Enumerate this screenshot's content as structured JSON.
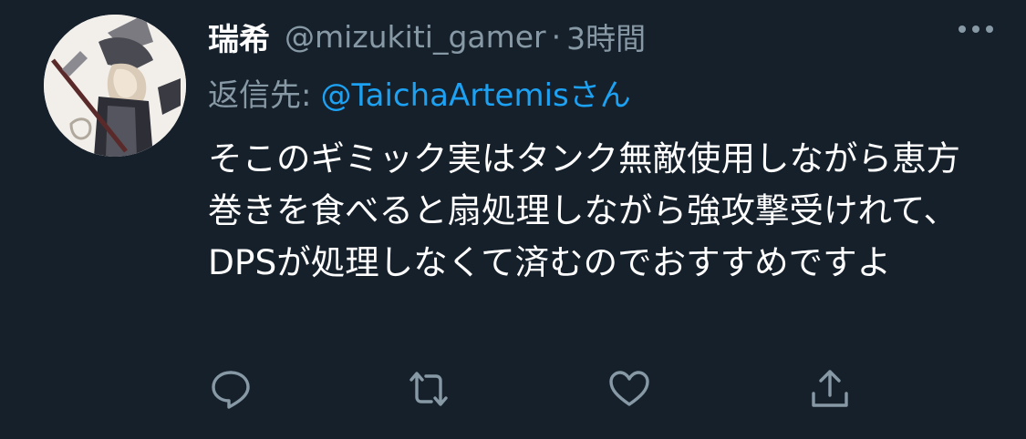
{
  "tweet": {
    "display_name": "瑞希",
    "handle": "@mizukiti_gamer",
    "separator": "·",
    "timestamp": "3時間",
    "reply_prefix": "返信先:",
    "reply_to": "@TaichaArtemisさん",
    "text": "そこのギミック実はタンク無敵使用しながら恵方巻きを食べると扇処理しながら強攻撃受けれて、DPSが処理しなくて済むのでおすすめですよ"
  },
  "icons": {
    "more": "more-horizontal-icon",
    "reply": "reply-icon",
    "retweet": "retweet-icon",
    "like": "heart-icon",
    "share": "share-icon"
  },
  "colors": {
    "background": "#15202b",
    "primary_text": "#ffffff",
    "secondary_text": "#8899a6",
    "accent": "#1da1f2"
  }
}
